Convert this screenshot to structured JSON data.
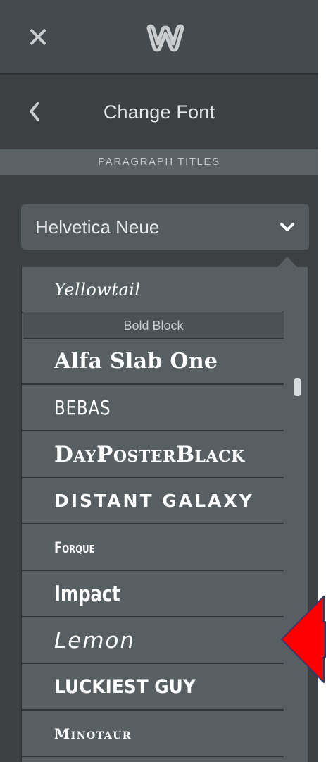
{
  "topbar": {
    "close_icon": "close-icon",
    "logo_icon": "weebly-logo-icon"
  },
  "header": {
    "back_icon": "chevron-left-icon",
    "title": "Change Font"
  },
  "section": {
    "label": "PARAGRAPH TITLES"
  },
  "font_select": {
    "value": "Helvetica Neue",
    "chevron_icon": "chevron-down-icon"
  },
  "dropdown": {
    "first_item": "Yellowtail",
    "group_header": "Bold Block",
    "items": [
      "Alfa Slab One",
      "BEBAS",
      "DayPosterBlack",
      "DISTANT GALAXY",
      "Forque",
      "Impact",
      "Lemon",
      "LUCKIEST GUY",
      "Minotaur"
    ]
  },
  "annotation": {
    "arrow_color": "#ff0000",
    "arrow_outline": "#2c3e6e"
  },
  "colors": {
    "panel_bg": "#3c4042",
    "topbar_bg": "#444a4d",
    "dropdown_bg": "#585f63"
  }
}
